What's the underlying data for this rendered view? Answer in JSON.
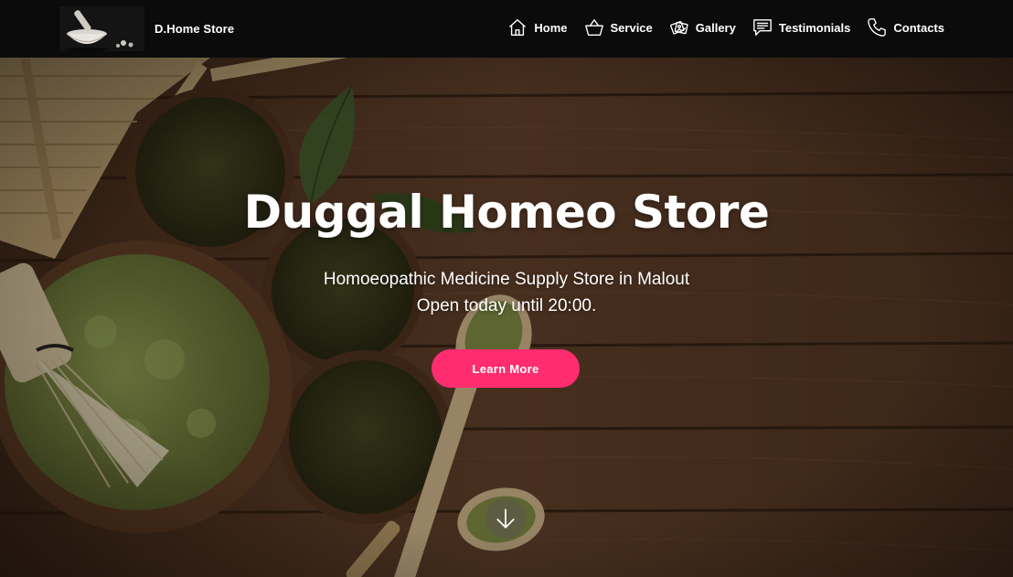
{
  "header": {
    "brand": "D.Home Store",
    "nav": [
      {
        "label": "Home",
        "icon": "home-icon"
      },
      {
        "label": "Service",
        "icon": "basket-icon"
      },
      {
        "label": "Gallery",
        "icon": "gallery-icon"
      },
      {
        "label": "Testimonials",
        "icon": "chat-icon"
      },
      {
        "label": "Contacts",
        "icon": "phone-icon"
      }
    ]
  },
  "hero": {
    "title": "Duggal Homeo Store",
    "subtitle_line1": "Homoeopathic Medicine Supply Store in Malout",
    "subtitle_line2": "Open today until 20:00.",
    "cta_label": "Learn More",
    "scroll_icon": "arrow-down-icon"
  },
  "colors": {
    "header_bg": "#0b0b0b",
    "accent": "#ff2d6f",
    "wood": "#5a3a26",
    "matcha": "#6f7f3e"
  }
}
